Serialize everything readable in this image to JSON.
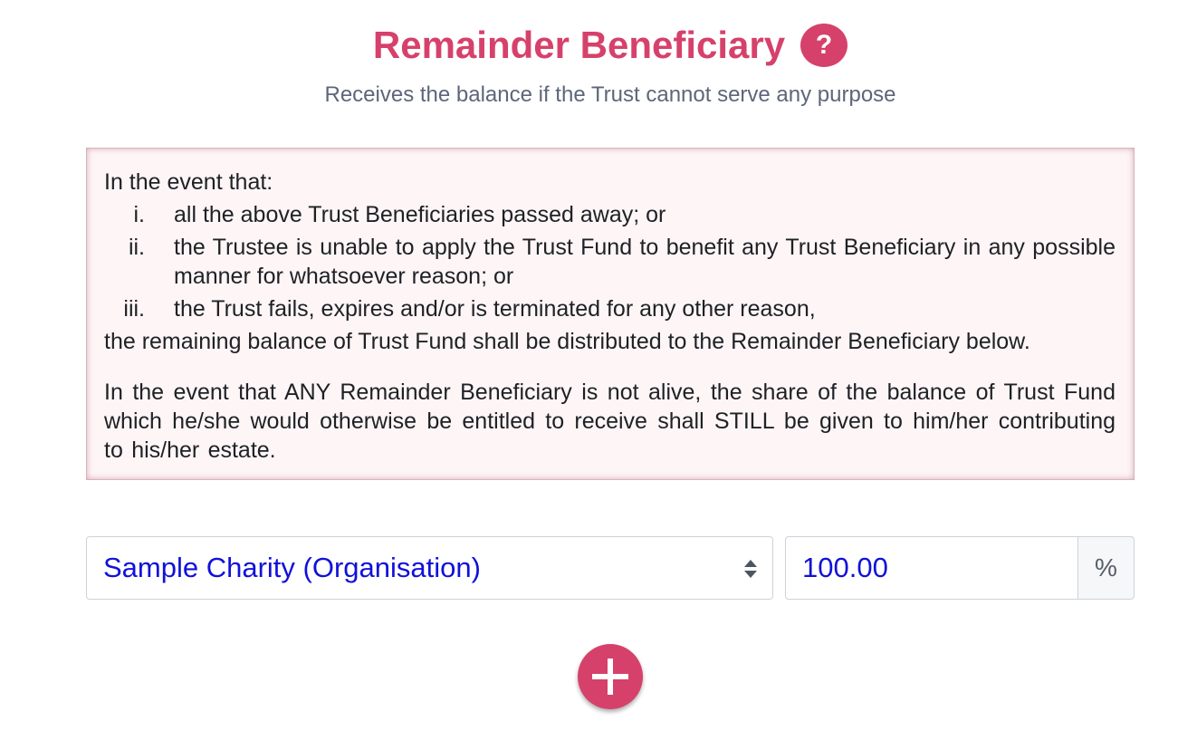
{
  "header": {
    "title": "Remainder Beneficiary",
    "help_label": "?",
    "subtitle": "Receives the balance if the Trust cannot serve any purpose"
  },
  "clause": {
    "intro": "In the event that:",
    "conditions": [
      {
        "numeral": "i.",
        "text": "all the above Trust Beneficiaries passed away; or"
      },
      {
        "numeral": "ii.",
        "text": "the Trustee is unable to apply the Trust Fund to benefit any Trust Beneficiary in any possible manner for whatsoever reason; or"
      },
      {
        "numeral": "iii.",
        "text": "the Trust fails, expires and/or is terminated for any other reason,"
      }
    ],
    "outcome": "the remaining balance of Trust Fund shall be distributed to the Remainder Beneficiary below.",
    "note": "In the event that ANY Remainder Beneficiary is not alive, the share of the balance of Trust Fund which he/she would otherwise be entitled to receive shall STILL be given to him/her contributing to his/her estate."
  },
  "beneficiary_row": {
    "selected_beneficiary": "Sample Charity (Organisation)",
    "share_value": "100.00",
    "share_unit": "%"
  },
  "icons": {
    "help": "question-mark-icon",
    "select": "select-arrows-icon",
    "add": "plus-icon"
  },
  "colors": {
    "accent": "#d6416b",
    "value_text": "#1111d9",
    "panel_background": "#fdf5f6"
  }
}
